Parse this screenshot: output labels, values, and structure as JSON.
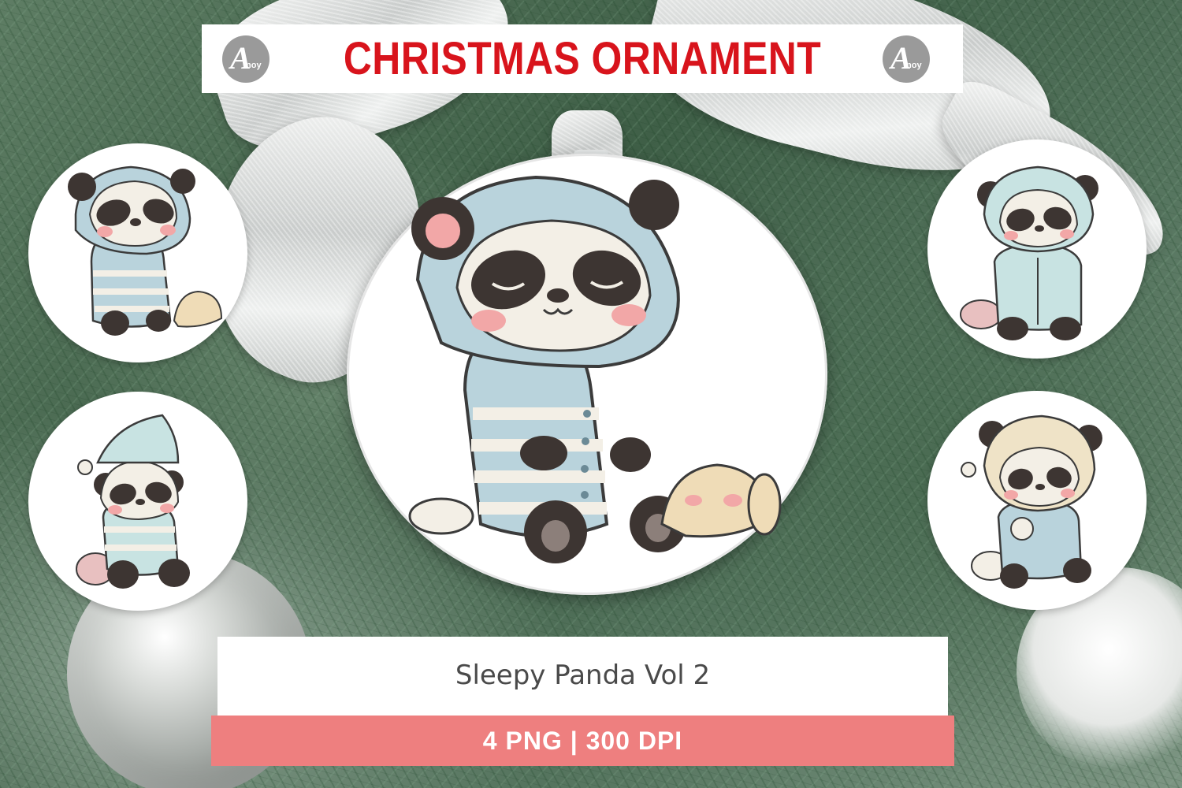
{
  "header": {
    "title": "CHRISTMAS ORNAMENT",
    "logo_left": {
      "glyph": "A",
      "small": "noy"
    },
    "logo_right": {
      "glyph": "A",
      "small": "noy"
    }
  },
  "product": {
    "name": "Sleepy Panda Vol 2",
    "specs": "4 PNG | 300 DPI"
  },
  "colors": {
    "title_red": "#d8141c",
    "spec_bar": "#ee7f7f",
    "pajama_blue": "#b9d3dc",
    "cheek_pink": "#f2a7a7"
  },
  "illustrations": [
    {
      "position": "main",
      "subject": "sleepy-panda-with-plush-bunny"
    },
    {
      "position": "top-left",
      "subject": "sleepy-panda-with-plush-bunny"
    },
    {
      "position": "bottom-left",
      "subject": "sleepy-panda-in-nightcap"
    },
    {
      "position": "top-right",
      "subject": "sleepy-panda-in-hoodie"
    },
    {
      "position": "bottom-right",
      "subject": "sleepy-panda-in-bear-hood"
    }
  ]
}
